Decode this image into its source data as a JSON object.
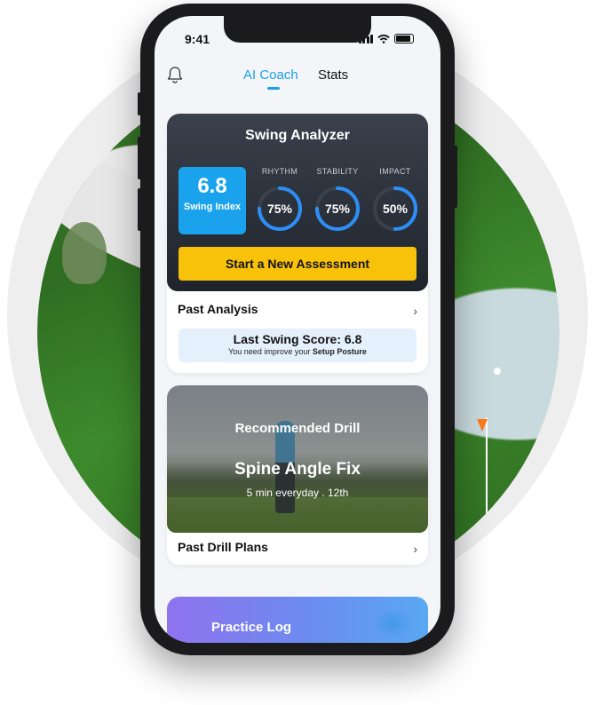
{
  "status": {
    "time": "9:41"
  },
  "nav": {
    "tabs": [
      {
        "label": "AI Coach",
        "active": true
      },
      {
        "label": "Stats",
        "active": false
      }
    ],
    "left_icon": "bell-icon"
  },
  "swing_analyzer": {
    "title": "Swing Analyzer",
    "swing_index": {
      "value": "6.8",
      "label": "Swing Index"
    },
    "metrics": [
      {
        "name": "RHYTHM",
        "value": "75%",
        "fraction": 0.75
      },
      {
        "name": "STABILITY",
        "value": "75%",
        "fraction": 0.75
      },
      {
        "name": "IMPACT",
        "value": "50%",
        "fraction": 0.5
      }
    ],
    "start_button": "Start a New Assessment",
    "past_analysis_label": "Past Analysis",
    "last_score": {
      "title": "Last Swing Score: 6.8",
      "sub_prefix": "You need improve your",
      "sub_focus": "Setup Posture"
    }
  },
  "drill": {
    "heading": "Recommended Drill",
    "name": "Spine Angle Fix",
    "meta": "5 min everyday . 12th",
    "past_plans_label": "Past Drill Plans"
  },
  "practice_log": {
    "title": "Practice Log"
  },
  "colors": {
    "accent": "#1aa0e8",
    "button": "#f9c20a",
    "ring": "#2d8ef5",
    "ring_track": "#3b414b"
  }
}
